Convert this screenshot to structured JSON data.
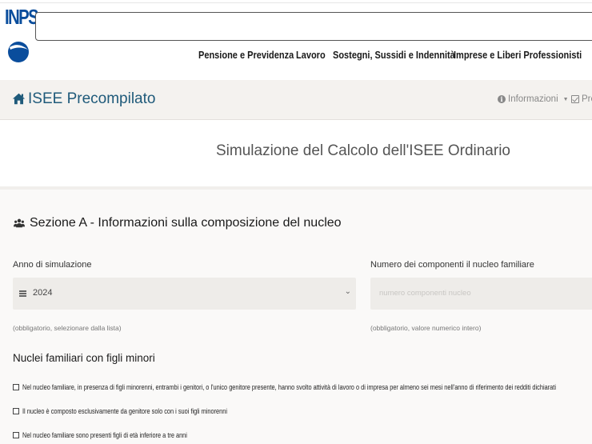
{
  "header": {
    "logo_text": "INPS",
    "nav": [
      "Pensione e Previdenza",
      "Lavoro",
      "Sostegni, Sussidi e Indennità",
      "Imprese e Liberi Professionisti"
    ]
  },
  "appbar": {
    "title": "ISEE Precompilato",
    "menu_info": "Informazioni",
    "menu_pre": "Pre"
  },
  "page_title": "Simulazione del Calcolo dell'ISEE Ordinario",
  "section": {
    "title": "Sezione A - Informazioni sulla composizione del nucleo",
    "year_label": "Anno di simulazione",
    "year_value": "2024",
    "year_help": "(obbligatorio, selezionare dalla lista)",
    "members_label": "Numero dei componenti il nucleo familiare",
    "members_placeholder": "numero componenti nucleo",
    "members_help": "(obbligatorio, valore numerico intero)",
    "subheading": "Nuclei familiari con figli minori",
    "checkboxes": [
      "Nel nucleo familiare, in presenza di figli minorenni, entrambi i genitori, o l'unico genitore presente, hanno svolto attività di lavoro o di impresa per almeno sei mesi nell'anno di riferimento dei redditi dichiarati",
      "Il nucleo è composto esclusivamente da genitore solo con i suoi figli minorenni",
      "Nel nucleo familiare sono presenti figli di età inferiore a tre anni"
    ]
  },
  "colors": {
    "brand_blue": "#0a4d9c",
    "title_teal": "#1f5a7a",
    "appbar_bg": "#f4f2ef"
  }
}
